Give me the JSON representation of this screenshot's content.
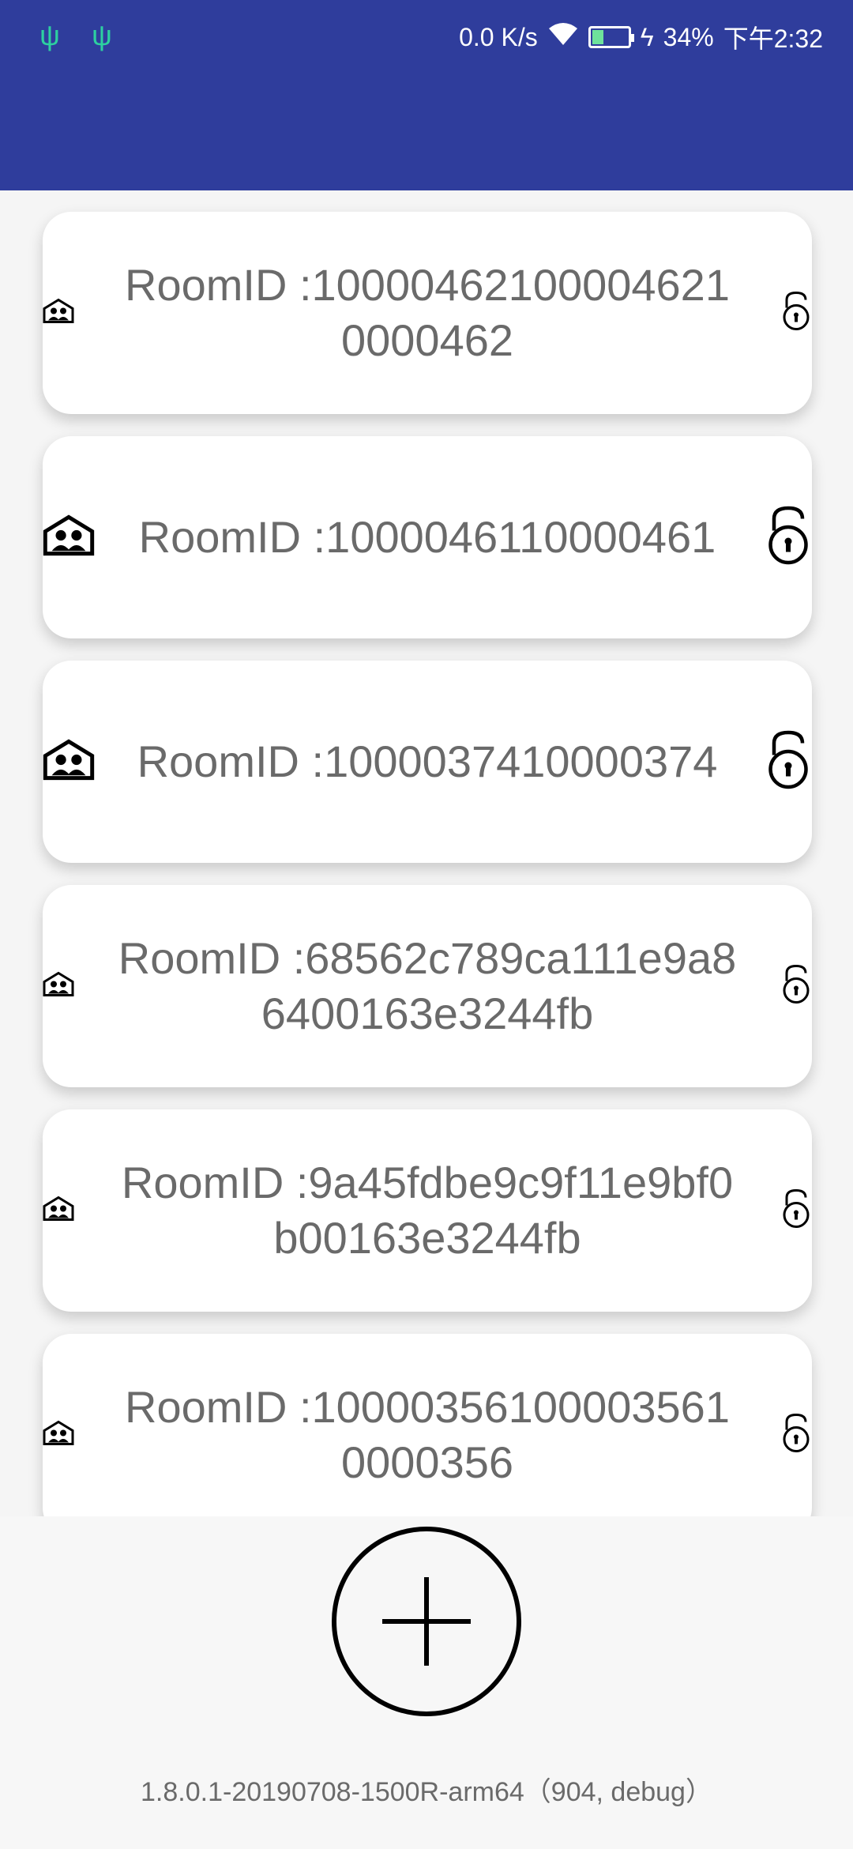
{
  "status_bar": {
    "left_icons": [
      "usb-icon",
      "usb-icon"
    ],
    "network_speed": "0.0 K/s",
    "battery_percent": "34%",
    "time": "下午2:32",
    "colors": {
      "left_icons": "#2dd0a0",
      "text": "#ffffff"
    }
  },
  "app_bar": {
    "background": "#2f3d9c"
  },
  "rooms": [
    {
      "label": "RoomID :100004621000046210000462",
      "icon": "room-icon",
      "lock_icon": "unlock-icon",
      "icon_size": "small"
    },
    {
      "label": "RoomID :1000046110000461",
      "icon": "room-icon",
      "lock_icon": "unlock-icon",
      "icon_size": "large"
    },
    {
      "label": "RoomID :1000037410000374",
      "icon": "room-icon",
      "lock_icon": "unlock-icon",
      "icon_size": "large"
    },
    {
      "label": "RoomID :68562c789ca111e9a86400163e3244fb",
      "icon": "room-icon",
      "lock_icon": "unlock-icon",
      "icon_size": "small"
    },
    {
      "label": "RoomID :9a45fdbe9c9f11e9bf0b00163e3244fb",
      "icon": "room-icon",
      "lock_icon": "unlock-icon",
      "icon_size": "small"
    },
    {
      "label": "RoomID :100003561000035610000356",
      "icon": "room-icon",
      "lock_icon": "unlock-icon",
      "icon_size": "small"
    }
  ],
  "add_button": {
    "icon": "plus-icon"
  },
  "footer": {
    "version": "1.8.0.1-20190708-1500R-arm64（904, debug）"
  }
}
